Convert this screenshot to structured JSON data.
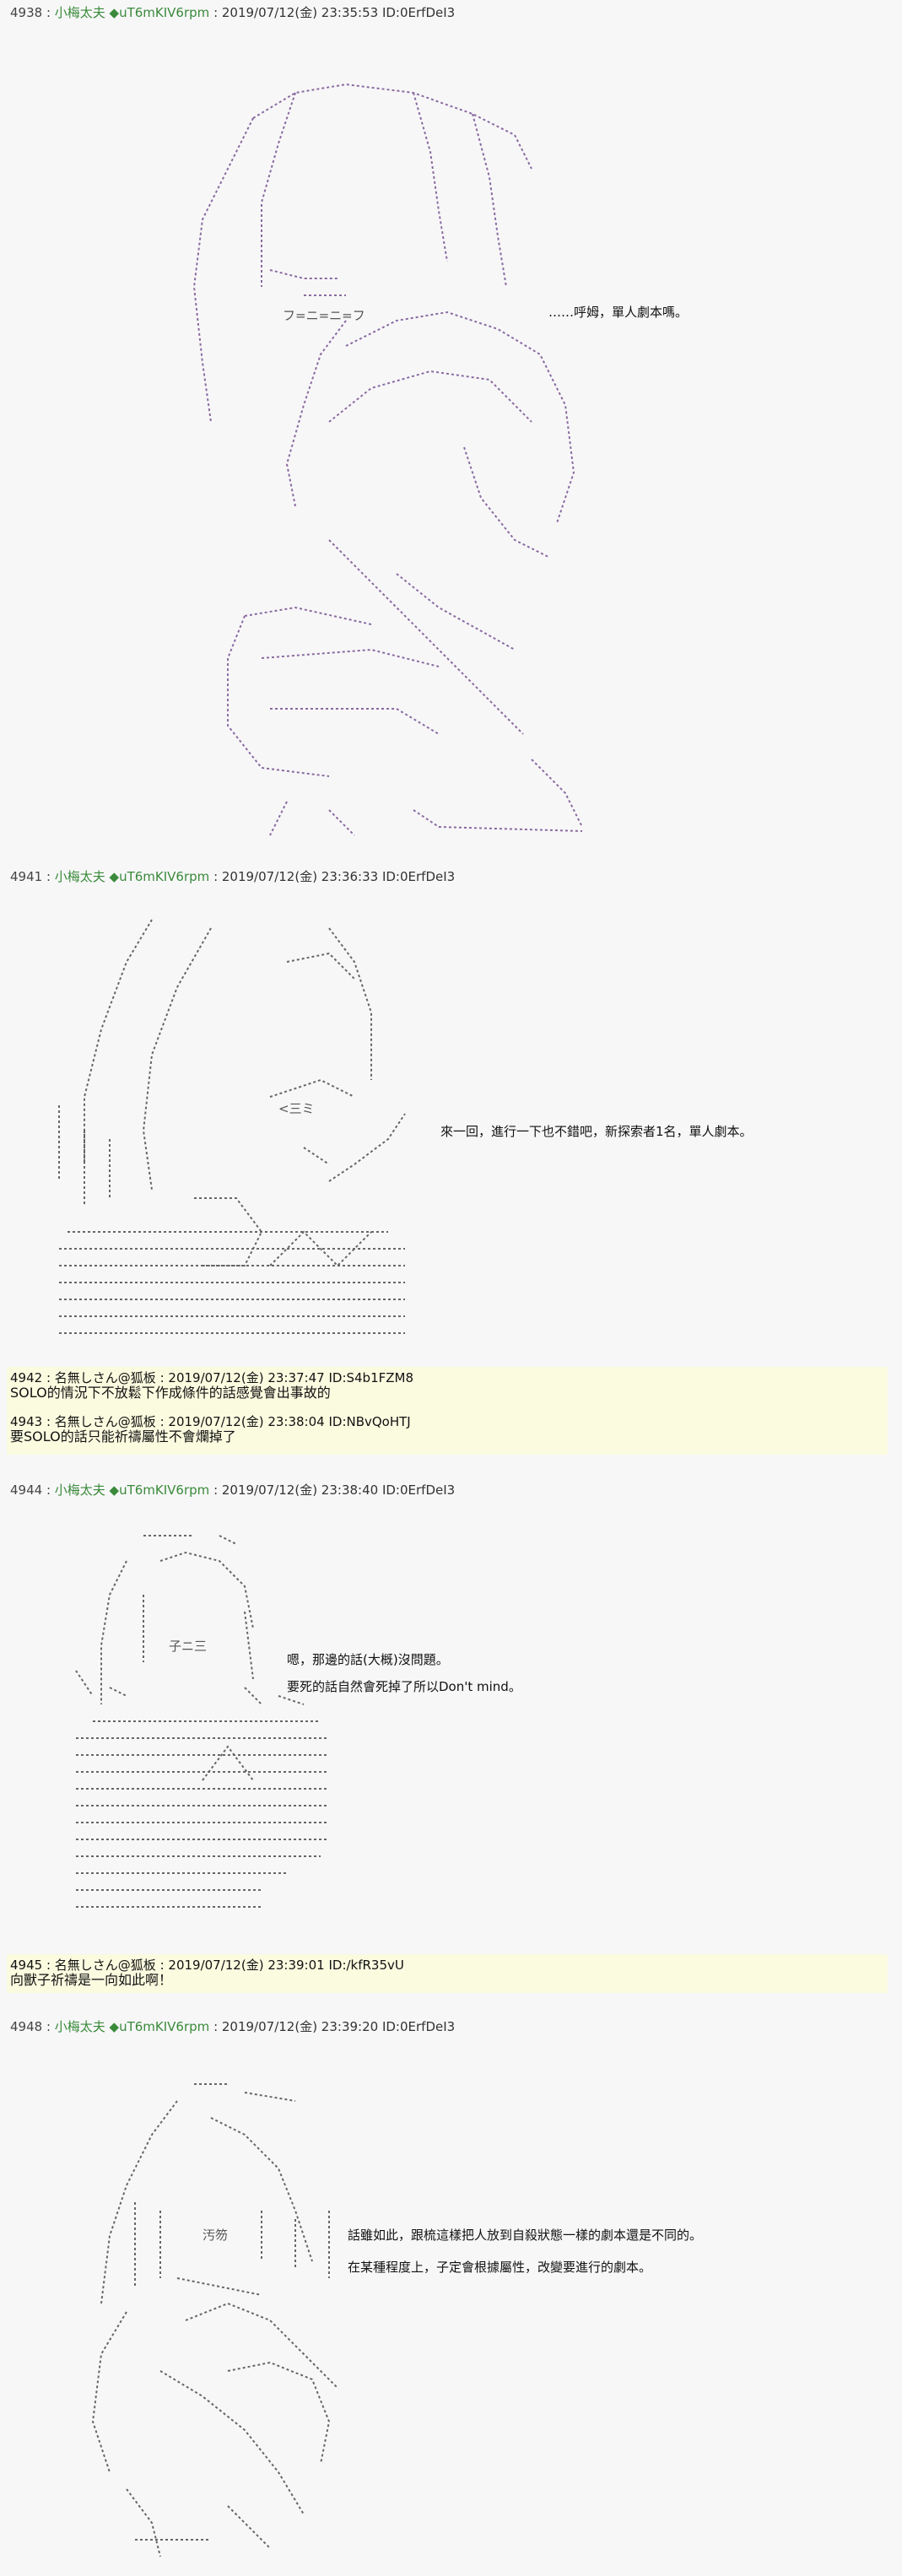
{
  "accent": {
    "author": "#3a8a3a",
    "art_purple": "#8a6aa0",
    "art_gray": "#666666",
    "reply_bg": "#fbfbe0"
  },
  "posts": [
    {
      "num": "4938 :",
      "author": "小梅太夫 ◆uT6mKIV6rpm",
      "meta": ": 2019/07/12(金) 23:35:53 ID:0ErfDeI3",
      "art_text": "フ=ニ=ニ=フ",
      "dialog": [
        "‥‥‥呼姆，單人劇本嗎。"
      ]
    },
    {
      "num": "4941 :",
      "author": "小梅太夫 ◆uT6mKIV6rpm",
      "meta": ": 2019/07/12(金) 23:36:33 ID:0ErfDeI3",
      "art_text": "<三ミ",
      "dialog": [
        "來一回，進行一下也不錯吧，新探索者1名，單人劇本。"
      ]
    },
    {
      "num": "4944 :",
      "author": "小梅太夫 ◆uT6mKIV6rpm",
      "meta": ": 2019/07/12(金) 23:38:40 ID:0ErfDeI3",
      "art_text": "子ニ三",
      "dialog": [
        "嗯，那邊的話(大概)沒問題。",
        "要死的話自然會死掉了所以Don't mind。"
      ]
    },
    {
      "num": "4948 :",
      "author": "小梅太夫 ◆uT6mKIV6rpm",
      "meta": ": 2019/07/12(金) 23:39:20 ID:0ErfDeI3",
      "art_text": "汚笏",
      "dialog": [
        "話雖如此，跟梳這樣把人放到自殺狀態一樣的劇本還是不同的。",
        "在某種程度上，子定會根據屬性，改變要進行的劇本。"
      ]
    }
  ],
  "replies": [
    {
      "entries": [
        {
          "num": "4942 :",
          "name": "名無しさん@狐板",
          "meta": ": 2019/07/12(金) 23:37:47 ID:S4b1FZM8",
          "body": "SOLO的情況下不放鬆下作成條件的話感覺會出事故的"
        },
        {
          "num": "4943 :",
          "name": "名無しさん@狐板",
          "meta": ": 2019/07/12(金) 23:38:04 ID:NBvQoHTJ",
          "body": "要SOLO的話只能祈禱屬性不會爛掉了"
        }
      ]
    },
    {
      "entries": [
        {
          "num": "4945 :",
          "name": "名無しさん@狐板",
          "meta": ": 2019/07/12(金) 23:39:01 ID:/kfR35vU",
          "body": "向獸子祈禱是一向如此啊！"
        }
      ]
    }
  ]
}
